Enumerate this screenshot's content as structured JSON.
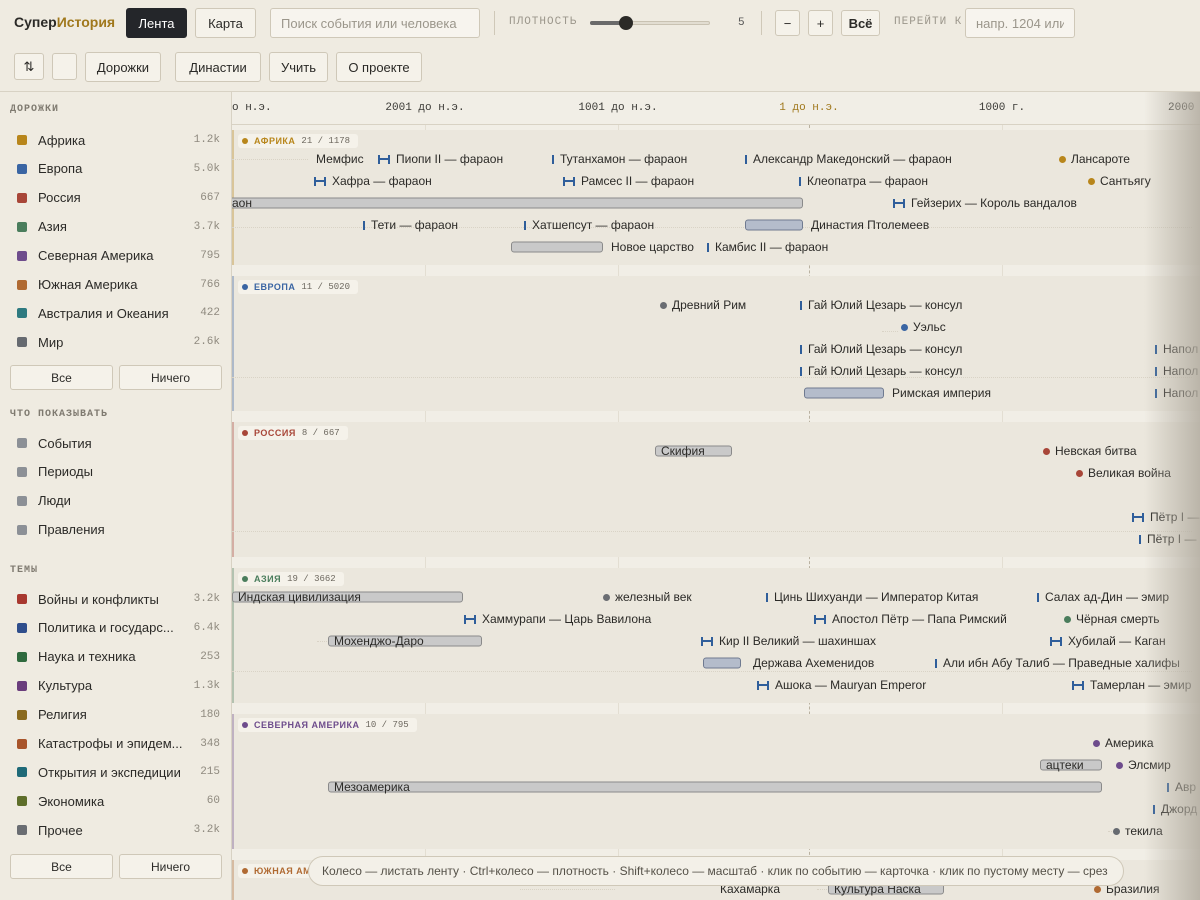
{
  "brand": {
    "part1": "Супер",
    "part2": "История"
  },
  "toolbar": {
    "tab_feed": "Лента",
    "tab_map": "Карта",
    "search_placeholder": "Поиск события или человека",
    "density_label": "ПЛОТНОСТЬ",
    "density_value": "5",
    "density_level_fraction": 0.3,
    "zoom_out": "−",
    "zoom_in": "+",
    "zoom_all": "Всё",
    "goto_label": "ПЕРЕЙТИ К",
    "goto_placeholder": "напр. 1204 или",
    "sort_icon": "⇅",
    "dorozhki": "Дорожки",
    "dynasties": "Династии",
    "learn": "Учить",
    "about": "О проекте"
  },
  "sidebar": {
    "tracks_title": "ДОРОЖКИ",
    "tracks": [
      {
        "label": "Африка",
        "count": "1.2k",
        "color": "#b8861b"
      },
      {
        "label": "Европа",
        "count": "5.0k",
        "color": "#3a65a3"
      },
      {
        "label": "Россия",
        "count": "667",
        "color": "#a84638"
      },
      {
        "label": "Азия",
        "count": "3.7k",
        "color": "#4a7d5c"
      },
      {
        "label": "Северная Америка",
        "count": "795",
        "color": "#6e4c8c"
      },
      {
        "label": "Южная Америка",
        "count": "766",
        "color": "#b06a32"
      },
      {
        "label": "Австралия и Океания",
        "count": "422",
        "color": "#2e7a80"
      },
      {
        "label": "Мир",
        "count": "2.6k",
        "color": "#666a70"
      }
    ],
    "tracks_all": "Все",
    "tracks_none": "Ничего",
    "show_title": "ЧТО ПОКАЗЫВАТЬ",
    "show": [
      {
        "label": "События",
        "color": "#8c9096"
      },
      {
        "label": "Периоды",
        "color": "#8c9096"
      },
      {
        "label": "Люди",
        "color": "#8c9096"
      },
      {
        "label": "Правления",
        "color": "#8c9096"
      }
    ],
    "themes_title": "ТЕМЫ",
    "themes": [
      {
        "label": "Войны и конфликты",
        "count": "3.2k",
        "color": "#a8382f"
      },
      {
        "label": "Политика и государс...",
        "count": "6.4k",
        "color": "#2f4e8c"
      },
      {
        "label": "Наука и техника",
        "count": "253",
        "color": "#2f6a3e"
      },
      {
        "label": "Культура",
        "count": "1.3k",
        "color": "#6a3d7c"
      },
      {
        "label": "Религия",
        "count": "180",
        "color": "#8a6a1e"
      },
      {
        "label": "Катастрофы и эпидем...",
        "count": "348",
        "color": "#a8542a"
      },
      {
        "label": "Открытия и экспедиции",
        "count": "215",
        "color": "#1f6a78"
      },
      {
        "label": "Экономика",
        "count": "60",
        "color": "#5e6e2a"
      },
      {
        "label": "Прочее",
        "count": "3.2k",
        "color": "#6a6d72"
      }
    ],
    "themes_all": "Все",
    "themes_none": "Ничего"
  },
  "axis": {
    "ticks": [
      "о н.э.",
      "2001 до н.э.",
      "1001 до н.э.",
      "1 до н.э.",
      "1000 г.",
      "2000"
    ]
  },
  "lanes": [
    {
      "name": "АФРИКА",
      "count": "21 / 1178",
      "color": "#b8861b",
      "events": [
        "Мемфис",
        "Пиопи II — фараон",
        "Тутанхамон — фараон",
        "Александр Македонский — фараон",
        "Лансароте",
        "Хафра — фараон",
        "Рамсес II — фараон",
        "Клеопатра — фараон",
        "Сантьягу",
        "Гейзерих — Король вандалов",
        "Тети — фараон",
        "Хатшепсут — фараон",
        "Династия Птолемеев",
        "Камбис II — фараон"
      ],
      "periods": [
        "аон",
        "Новое царство"
      ]
    },
    {
      "name": "ЕВРОПА",
      "count": "11 / 5020",
      "color": "#3a65a3",
      "events": [
        "Древний Рим",
        "Гай Юлий Цезарь — консул",
        "Уэльс",
        "Гай Юлий Цезарь — консул",
        "Гай Юлий Цезарь — консул",
        "Римская империя",
        "Напол",
        "Напол",
        "Напол"
      ]
    },
    {
      "name": "РОССИЯ",
      "count": "8 / 667",
      "color": "#a84638",
      "events": [
        "Невская битва",
        "Великая война",
        "Пётр I —",
        "Пётр I —"
      ],
      "periods": [
        "Скифия"
      ]
    },
    {
      "name": "АЗИЯ",
      "count": "19 / 3662",
      "color": "#4a7d5c",
      "events": [
        "железный век",
        "Цинь Шихуанди — Император Китая",
        "Салах ад-Дин — эмир",
        "Хаммурапи — Царь Вавилона",
        "Апостол Пётр — Папа Римский",
        "Чёрная смерть",
        "Кир II Великий — шахиншах",
        "Хубилай — Каган",
        "Держава Ахеменидов",
        "Али ибн Абу Талиб — Праведные халифы",
        "Ашока — Mauryan Emperor",
        "Тамерлан — эмир"
      ],
      "periods": [
        "Индская цивилизация",
        "Мохенджо-Даро"
      ]
    },
    {
      "name": "СЕВЕРНАЯ АМЕРИКА",
      "count": "10 / 795",
      "color": "#6e4c8c",
      "events": [
        "Америка",
        "Элсмир",
        "Авр",
        "Джорд",
        "текила"
      ],
      "periods": [
        "ацтеки",
        "Мезоамерика"
      ]
    },
    {
      "name": "ЮЖНАЯ АМ",
      "count": "",
      "color": "#b06a32",
      "events": [
        "Кахамарка",
        "Бразилия"
      ],
      "periods": [
        "Культура Наска"
      ]
    }
  ],
  "hint": "Колесо — листать ленту · Ctrl+колесо — плотность · Shift+колесо — масштаб · клик по событию — карточка · клик по пустому месту — срез"
}
